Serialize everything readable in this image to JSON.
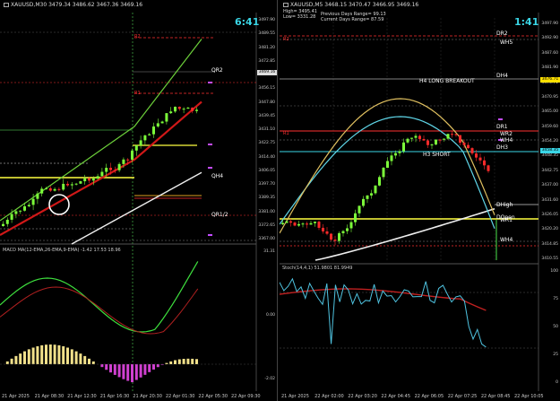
{
  "left": {
    "symbol_header": "XAUUSD,M30",
    "ohlc": "3479.34 3486.62 3467.36 3469.16",
    "clock": "6:41",
    "levels": {
      "qr2": "QR2",
      "qh4": "QH4",
      "qr1_2": "QR1/2",
      "r2": "R2",
      "r1": "R1"
    },
    "price_axis": [
      "3497.90",
      "3489.55",
      "3481.20",
      "3472.85",
      "3464.50",
      "3456.15",
      "3447.80",
      "3439.45",
      "3431.10",
      "3422.75",
      "3414.40",
      "3406.05",
      "3397.70",
      "3389.35",
      "3381.00",
      "3372.65",
      "3367.00"
    ],
    "price_tag": "3469.16",
    "macd_header": "MACD MA(12-EMA,26-EMA,9-EMA) -1.42 17.53 18.96",
    "macd_axis": [
      "31.31",
      "0.00",
      "-2.02"
    ],
    "time_axis": [
      "21 Apr 2025",
      "21 Apr 08:30",
      "21 Apr 12:30",
      "21 Apr 16:30",
      "21 Apr 20:30",
      "22 Apr 01:30",
      "22 Apr 05:30",
      "22 Apr 09:30"
    ]
  },
  "right": {
    "symbol_header": "XAUUSD,M5",
    "ohlc": "3468.15 3470.47 3466.95 3469.16",
    "info_lines": [
      "High= 3495.41",
      "Low= 3331.28",
      "Previous Days Range= 99.13",
      "Current Days Range= 87.59"
    ],
    "clock": "1:41",
    "levels": {
      "dr2": "DR2",
      "wh5": "WH5",
      "dh4": "DH4",
      "h4_long_breakout": "H4 LONG BREAKOUT",
      "dr1": "DR1",
      "wr2": "WR2",
      "wh4": "WH4",
      "dh3": "DH3",
      "h3_short": "H3 SHORT",
      "dhigh": "DHigh",
      "dopen": "DOpen",
      "wr1": "WR1",
      "wh4b": "WH4",
      "r2": "R2",
      "r1": "R1"
    },
    "price_axis": [
      "3497.90",
      "3492.90",
      "3487.60",
      "3481.90",
      "3476.71",
      "3470.95",
      "3465.00",
      "3459.60",
      "3454.20",
      "3448.35",
      "3442.75",
      "3437.00",
      "3431.60",
      "3426.05",
      "3420.20",
      "3414.85",
      "3410.55"
    ],
    "price_tag_top": "3476.71",
    "price_tag_mid": "3458.35",
    "stoch_header": "Stoch(14,4,1) 51.9801 81.9949",
    "stoch_axis": [
      "100",
      "75",
      "50",
      "25",
      "0"
    ],
    "time_axis": [
      "21 Apr 2025",
      "22 Apr 02:00",
      "22 Apr 03:20",
      "22 Apr 04:45",
      "22 Apr 06:05",
      "22 Apr 07:25",
      "22 Apr 08:45",
      "22 Apr 10:05"
    ]
  },
  "colors": {
    "bull": "#7cfc3a",
    "bear": "#ff2a2a",
    "accent_cyan": "#3ad6e6",
    "yellow": "#ffff40",
    "level_red": "#ff3030"
  }
}
